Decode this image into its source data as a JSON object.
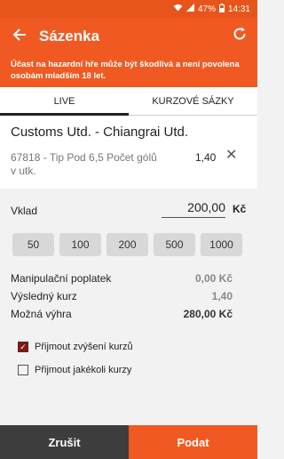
{
  "status_bar": {
    "battery": "47%",
    "time": "14:31"
  },
  "app_bar": {
    "title": "Sázenka"
  },
  "warning": "Účast na hazardní hře může být škodlivá a není povolena osobám mladším 18 let.",
  "tabs": [
    {
      "label": "LIVE",
      "active": true
    },
    {
      "label": "KURZOVÉ SÁZKY",
      "active": false
    }
  ],
  "event": {
    "name": "Customs Utd. - Chiangrai Utd.",
    "bet": "67818 - Tip Pod 6,5 Počet gólů v utk.",
    "odds": "1,40"
  },
  "stake": {
    "label": "Vklad",
    "value": "200,00",
    "currency": "Kč"
  },
  "quick_amounts": [
    "50",
    "100",
    "200",
    "500",
    "1000"
  ],
  "summary": [
    {
      "label": "Manipulační poplatek",
      "value": "0,00 Kč"
    },
    {
      "label": "Výsledný kurz",
      "value": "1,40"
    },
    {
      "label": "Možná výhra",
      "value": "280,00 Kč"
    }
  ],
  "options": [
    {
      "label": "Přijmout zvýšení kurzů",
      "checked": true
    },
    {
      "label": "Přijmout jakékoli kurzy",
      "checked": false
    }
  ],
  "buttons": {
    "cancel": "Zrušit",
    "submit": "Podat"
  }
}
